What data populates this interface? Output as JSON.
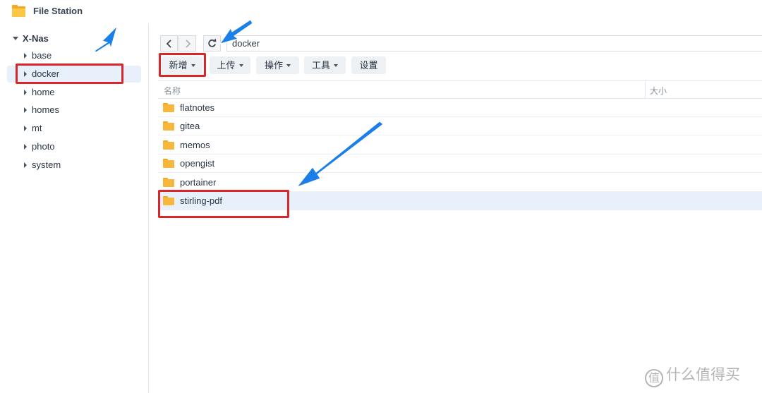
{
  "app": {
    "title": "File Station",
    "icon": "folder-icon"
  },
  "sidebar": {
    "root": "X-Nas",
    "items": [
      {
        "label": "base",
        "selected": false
      },
      {
        "label": "docker",
        "selected": true
      },
      {
        "label": "home",
        "selected": false
      },
      {
        "label": "homes",
        "selected": false
      },
      {
        "label": "mt",
        "selected": false
      },
      {
        "label": "photo",
        "selected": false
      },
      {
        "label": "system",
        "selected": false
      }
    ]
  },
  "navigation": {
    "back_icon": "chevron-left-icon",
    "forward_icon": "chevron-right-icon",
    "refresh_icon": "refresh-icon",
    "path": "docker"
  },
  "toolbar": {
    "new_label": "新增",
    "upload_label": "上传",
    "action_label": "操作",
    "tools_label": "工具",
    "settings_label": "设置"
  },
  "table": {
    "columns": [
      "名称",
      "大小"
    ],
    "rows": [
      {
        "name": "flatnotes",
        "selected": false
      },
      {
        "name": "gitea",
        "selected": false
      },
      {
        "name": "memos",
        "selected": false
      },
      {
        "name": "opengist",
        "selected": false
      },
      {
        "name": "portainer",
        "selected": false
      },
      {
        "name": "stirling-pdf",
        "selected": true
      }
    ]
  },
  "watermark": {
    "logo": "值",
    "text": "什么值得买"
  },
  "colors": {
    "accent": "#1a7fe8",
    "highlight": "#d8262a",
    "folder": "#f6b73c",
    "selected_row": "#e8f1fb"
  }
}
